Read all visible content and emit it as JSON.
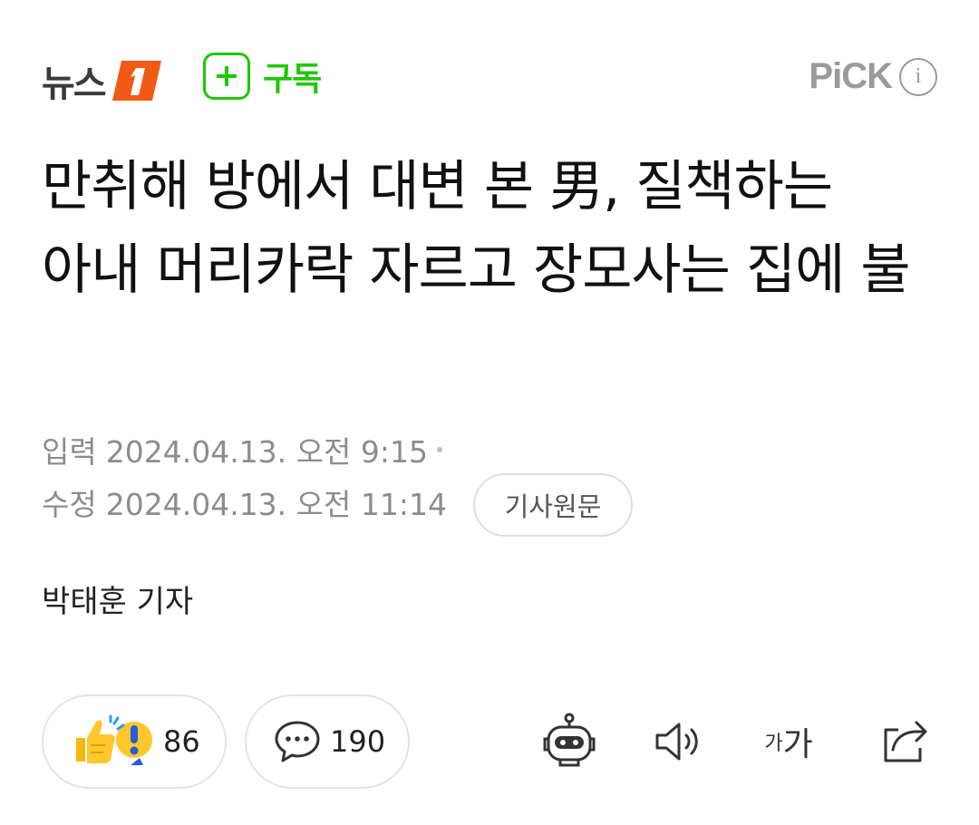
{
  "header": {
    "brand_text": "뉴스",
    "subscribe_label": "구독",
    "pick_label": "PiCK",
    "info_label": "i"
  },
  "article": {
    "title": "만취해 방에서 대변 본 男, 질책하는 아내 머리카락 자르고 장모사는 집에 불",
    "input_label": "입력",
    "input_time": "2024.04.13. 오전 9:15",
    "edit_label": "수정",
    "edit_time": "2024.04.13. 오전 11:14",
    "source_button": "기사원문",
    "reporter": "박태훈 기자"
  },
  "actions": {
    "reaction_count": "86",
    "comment_count": "190",
    "font_small": "가",
    "font_big": "가"
  },
  "colors": {
    "subscribe_green": "#1ec800",
    "brand_orange": "#f05a14",
    "meta_gray": "#8c8c8c"
  }
}
